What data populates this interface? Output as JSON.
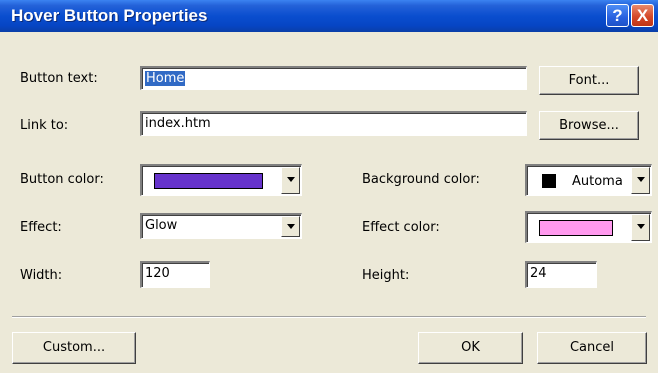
{
  "window": {
    "title": "Hover Button Properties",
    "help_label": "?",
    "close_label": "X"
  },
  "button_text": {
    "label": "Button text:",
    "value": "Home"
  },
  "link_to": {
    "label": "Link to:",
    "value": "index.htm"
  },
  "font_button": "Font...",
  "browse_button": "Browse...",
  "button_color": {
    "label": "Button color:",
    "color": "#6633cc"
  },
  "background_color": {
    "label": "Background color:",
    "swatch_color": "#000000",
    "value": "Automa"
  },
  "effect": {
    "label": "Effect:",
    "value": "Glow"
  },
  "effect_color": {
    "label": "Effect color:",
    "color": "#ff99ee"
  },
  "width": {
    "label": "Width:",
    "value": "120"
  },
  "height": {
    "label": "Height:",
    "value": "24"
  },
  "buttons": {
    "custom": "Custom...",
    "ok": "OK",
    "cancel": "Cancel"
  }
}
